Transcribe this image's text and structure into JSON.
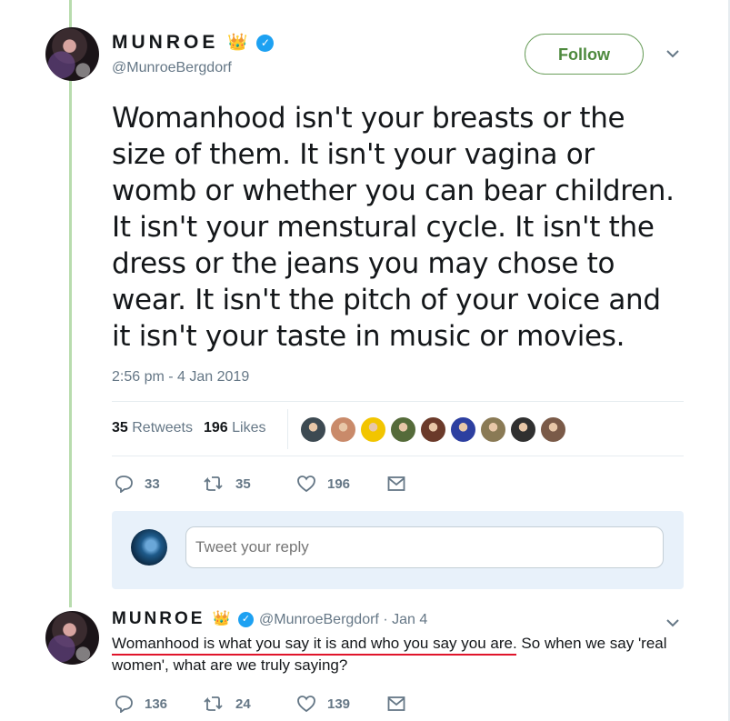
{
  "tweet": {
    "display_name": "MUNROE",
    "name_emoji": "👑",
    "handle": "@MunroeBergdorf",
    "follow_label": "Follow",
    "text": "Womanhood isn't your breasts or the size of them. It isn't your vagina or womb or whether you can bear children. It isn't your menstural cycle. It isn't the dress or the jeans you may chose to wear. It isn't the pitch of your voice and it isn't your taste in music or movies.",
    "timestamp": "2:56 pm - 4 Jan 2019",
    "retweets_count": "35",
    "retweets_label": "Retweets",
    "likes_count": "196",
    "likes_label": "Likes",
    "liker_colors": [
      "#3d4a52",
      "#c98a6a",
      "#f2c500",
      "#556b3a",
      "#6b3a2a",
      "#2d3fa0",
      "#8a7a55",
      "#303030",
      "#7a5a48"
    ],
    "actions": {
      "replies": "33",
      "retweets": "35",
      "likes": "196"
    }
  },
  "reply_box": {
    "placeholder": "Tweet your reply"
  },
  "reply_tweet": {
    "display_name": "MUNROE",
    "name_emoji": "👑",
    "handle": "@MunroeBergdorf",
    "separator": "·",
    "date": "Jan 4",
    "text": "Womanhood is what you say it is and who you say you are. So when we say 'real women', what are we truly saying?",
    "actions": {
      "replies": "136",
      "retweets": "24",
      "likes": "139"
    }
  },
  "colors": {
    "accent_green": "#4e8a3e",
    "thread_line": "#b8dcae",
    "verified_blue": "#1da1f2",
    "underline_red": "#e0142a",
    "muted": "#657786"
  },
  "icons": {
    "reply": "reply-icon",
    "retweet": "retweet-icon",
    "like": "heart-icon",
    "dm": "envelope-icon",
    "verified": "verified-badge-icon",
    "more": "chevron-down-icon"
  }
}
